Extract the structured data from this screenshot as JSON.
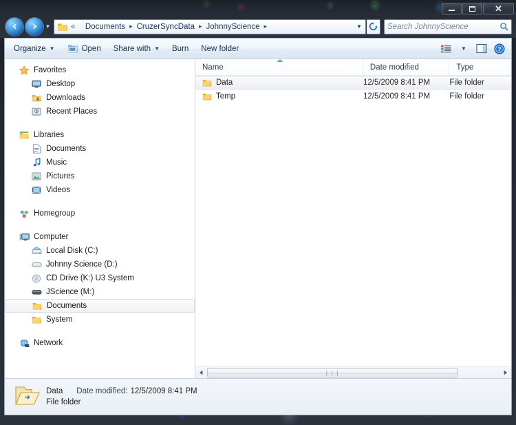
{
  "window": {
    "buttons": {
      "minimize": "minimize",
      "maximize": "maximize",
      "close": "close"
    }
  },
  "addressbar": {
    "back_title": "Back",
    "forward_title": "Forward",
    "history_title": "Recent pages",
    "overflow": "«",
    "crumbs": [
      "Documents",
      "CruzerSyncData",
      "JohnnyScience"
    ],
    "separator": "▸",
    "dropdown": "▼",
    "refresh": "refresh-icon",
    "search_placeholder": "Search JohnnyScience",
    "search_value": ""
  },
  "toolbar": {
    "organize": "Organize",
    "open": "Open",
    "share_with": "Share with",
    "burn": "Burn",
    "new_folder": "New folder",
    "view_icon": "view-options-icon",
    "view_caret": "▼",
    "preview_pane_icon": "preview-pane-icon",
    "help_icon": "help-icon"
  },
  "navpane": {
    "groups": [
      {
        "header": {
          "label": "Favorites",
          "icon": "star-icon"
        },
        "items": [
          {
            "label": "Desktop",
            "icon": "desktop-icon"
          },
          {
            "label": "Downloads",
            "icon": "downloads-folder-icon"
          },
          {
            "label": "Recent Places",
            "icon": "recent-places-icon"
          }
        ]
      },
      {
        "header": {
          "label": "Libraries",
          "icon": "libraries-icon"
        },
        "items": [
          {
            "label": "Documents",
            "icon": "documents-library-icon"
          },
          {
            "label": "Music",
            "icon": "music-library-icon"
          },
          {
            "label": "Pictures",
            "icon": "pictures-library-icon"
          },
          {
            "label": "Videos",
            "icon": "videos-library-icon"
          }
        ]
      },
      {
        "header": {
          "label": "Homegroup",
          "icon": "homegroup-icon"
        },
        "items": []
      },
      {
        "header": {
          "label": "Computer",
          "icon": "computer-icon"
        },
        "items": [
          {
            "label": "Local Disk (C:)",
            "icon": "hard-drive-icon"
          },
          {
            "label": "Johnny Science (D:)",
            "icon": "removable-drive-icon"
          },
          {
            "label": "CD Drive (K:) U3 System",
            "icon": "cd-drive-icon"
          },
          {
            "label": "JScience (M:)",
            "icon": "removable-drive-icon"
          },
          {
            "label": "Documents",
            "icon": "folder-icon",
            "indent": 2,
            "selected": true
          },
          {
            "label": "System",
            "icon": "folder-icon",
            "indent": 2
          }
        ]
      },
      {
        "header": {
          "label": "Network",
          "icon": "network-icon"
        },
        "items": []
      }
    ]
  },
  "filelist": {
    "columns": [
      {
        "key": "name",
        "label": "Name",
        "sort": "ascending"
      },
      {
        "key": "date",
        "label": "Date modified"
      },
      {
        "key": "type",
        "label": "Type"
      }
    ],
    "rows": [
      {
        "name": "Data",
        "date": "12/5/2009 8:41 PM",
        "type": "File folder",
        "icon": "folder-icon",
        "selected": true
      },
      {
        "name": "Temp",
        "date": "12/5/2009 8:41 PM",
        "type": "File folder",
        "icon": "folder-icon",
        "selected": false
      }
    ],
    "scrollbar": {
      "left_arrow": "◀",
      "right_arrow": "▶",
      "grip": "❘❘❘"
    }
  },
  "details": {
    "icon": "open-folder-large-icon",
    "name": "Data",
    "date_modified_label": "Date modified:",
    "date_modified_value": "12/5/2009 8:41 PM",
    "kind": "File folder"
  },
  "colors": {
    "folder_yellow": "#fcd46a",
    "folder_yellow_dark": "#e2a730",
    "accent_blue": "#2f7fd1",
    "selection_gray": "#eceff2",
    "link_text": "#15385c"
  }
}
